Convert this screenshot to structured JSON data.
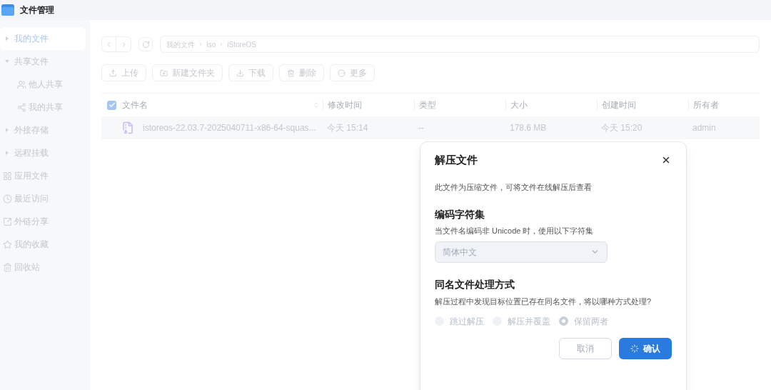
{
  "app": {
    "title": "文件管理"
  },
  "sidebar": {
    "items": [
      {
        "label": "我的文件",
        "kind": "tree",
        "selected": true,
        "expanded": false
      },
      {
        "label": "共享文件",
        "kind": "tree",
        "selected": false,
        "expanded": true,
        "children": [
          {
            "label": "他人共享",
            "selected": false
          },
          {
            "label": "我的共享",
            "selected": false
          }
        ]
      },
      {
        "label": "外接存储",
        "kind": "tree",
        "selected": false,
        "expanded": false
      },
      {
        "label": "远程挂载",
        "kind": "tree",
        "selected": false,
        "expanded": false
      },
      {
        "label": "应用文件",
        "kind": "link",
        "selected": false
      },
      {
        "label": "最近访问",
        "kind": "link",
        "selected": false
      },
      {
        "label": "外链分享",
        "kind": "link",
        "selected": false
      },
      {
        "label": "我的收藏",
        "kind": "link",
        "selected": false
      },
      {
        "label": "回收站",
        "kind": "link",
        "selected": false
      }
    ]
  },
  "breadcrumb": [
    "我的文件",
    "Iso",
    "iStoreOS"
  ],
  "toolbar": [
    "上传",
    "新建文件夹",
    "下载",
    "删除",
    "更多"
  ],
  "table": {
    "all_checked": true,
    "columns": [
      "文件名",
      "修改时间",
      "类型",
      "大小",
      "创建时间",
      "所有者"
    ],
    "rows": [
      {
        "cells": [
          "istoreos-22.03.7-2025040711-x86-64-squas...",
          "今天 15:14",
          "--",
          "178.6 MB",
          "今天 15:20",
          "admin"
        ]
      }
    ]
  },
  "dialog": {
    "title": "解压文件",
    "intro": "此文件为压缩文件，可将文件在线解压后查看",
    "charset": {
      "heading": "编码字符集",
      "hint": "当文件名编码非 Unicode 时，使用以下字符集",
      "value": "简体中文"
    },
    "conflict": {
      "heading": "同名文件处理方式",
      "hint": "解压过程中发现目标位置已存在同名文件，将以哪种方式处理?",
      "options": [
        {
          "label": "跳过解压",
          "selected": false
        },
        {
          "label": "解压并覆盖",
          "selected": false
        },
        {
          "label": "保留两者",
          "selected": true
        }
      ]
    },
    "buttons": [
      {
        "label": "取消",
        "kind": "secondary",
        "loading": false
      },
      {
        "label": "确认",
        "kind": "primary",
        "loading": true
      }
    ]
  }
}
